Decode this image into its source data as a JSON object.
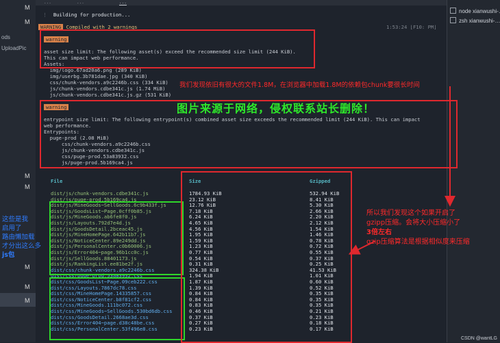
{
  "tabs": [
    "...",
    "...",
    "..."
  ],
  "sidebar": {
    "labels": [
      "ods",
      "UploadPic"
    ],
    "markers": [
      "M",
      "M",
      "M",
      "M",
      "M",
      "M",
      "M"
    ]
  },
  "right_panel": {
    "items": [
      "node  xianwushi-…",
      "zsh  xianwushi-…"
    ]
  },
  "terminal": {
    "building": "Building for production...",
    "compiled_badge": "WARNING",
    "compiled_text": " Compiled with 2 warnings",
    "time": "1:53:24 ⌊F10: PM⌋",
    "warn1_badge": "warning",
    "warn1_line1": "asset size limit: The following asset(s) exceed the recommended size limit (244 KiB).",
    "warn1_line2": "This can impact web performance.",
    "assets_header": "Assets:",
    "assets": [
      "  img/logo.67ad20a6.png (289 KiB)",
      "  img/userbg.3b781dae.jpg (340 KiB)",
      "  css/chunk-vendors.a9c2246b.css (334 KiB)",
      "  js/chunk-vendors.cdbe341c.js (1.74 MiB)",
      "  js/chunk-vendors.cdbe341c.js.gz (531 KiB)"
    ],
    "warn2_badge": "warning",
    "warn2_line1": "entrypoint size limit: The following entrypoint(s) combined asset size exceeds the recommended limit (244 KiB). This can impact",
    "warn2_line2": "web performance.",
    "entrypoints_header": "Entrypoints:",
    "entrypoints": [
      "  puge-prod (2.08 MiB)",
      "      css/chunk-vendors.a9c2246b.css",
      "      js/chunk-vendors.cdbe341c.js",
      "      css/puge-prod.53a83932.css",
      "      js/puge-prod.5b169ca4.js"
    ],
    "table": {
      "headers": {
        "file": "File",
        "size": "Size",
        "gzipped": "Gzipped"
      },
      "rows": [
        {
          "file": "dist/js/chunk-vendors.cdbe341c.js",
          "size": "1784.93 KiB",
          "gz": "532.94 KiB",
          "kind": "js"
        },
        {
          "file": "dist/js/puge-prod.5b169ca4.js",
          "size": "23.12 KiB",
          "gz": "8.41 KiB",
          "kind": "js"
        },
        {
          "file": "dist/js/MineGoods~SellGoods.6c9b433f.js",
          "size": "12.76 KiB",
          "gz": "5.30 KiB",
          "kind": "js"
        },
        {
          "file": "dist/js/GoodsList~Page.0cff0b85.js",
          "size": "7.18 KiB",
          "gz": "2.66 KiB",
          "kind": "js"
        },
        {
          "file": "dist/js/MineGoods.ab6fe8f0.js",
          "size": "6.24 KiB",
          "gz": "2.20 KiB",
          "kind": "js"
        },
        {
          "file": "dist/js/Layouts.792d7e4d.js",
          "size": "4.65 KiB",
          "gz": "2.12 KiB",
          "kind": "js"
        },
        {
          "file": "dist/js/GoodsDetail.2bceac45.js",
          "size": "4.56 KiB",
          "gz": "1.54 KiB",
          "kind": "js"
        },
        {
          "file": "dist/js/MineHomePage.642b11b7.js",
          "size": "1.95 KiB",
          "gz": "1.46 KiB",
          "kind": "js"
        },
        {
          "file": "dist/js/NoticeCenter.89e249dd.js",
          "size": "1.59 KiB",
          "gz": "0.78 KiB",
          "kind": "js"
        },
        {
          "file": "dist/js/PersonalCenter.c0b60006.js",
          "size": "1.23 KiB",
          "gz": "0.72 KiB",
          "kind": "js"
        },
        {
          "file": "dist/js/Error404~page.96b1cc0c.js",
          "size": "0.77 KiB",
          "gz": "0.55 KiB",
          "kind": "js"
        },
        {
          "file": "dist/js/SellGoods.88401173.js",
          "size": "0.54 KiB",
          "gz": "0.37 KiB",
          "kind": "js"
        },
        {
          "file": "dist/js/RankingList.ee81be2f.js",
          "size": "0.31 KiB",
          "gz": "0.25 KiB",
          "kind": "js"
        },
        {
          "file": "dist/css/chunk-vendors.a9c2246b.css",
          "size": "324.38 KiB",
          "gz": "41.53 KiB",
          "kind": "css"
        },
        {
          "file": "dist/css/puge-prod.53a83932.css",
          "size": "1.94 KiB",
          "gz": "1.01 KiB",
          "kind": "css"
        },
        {
          "file": "dist/css/GoodsList~Page.09ceb222.css",
          "size": "1.87 KiB",
          "gz": "0.60 KiB",
          "kind": "css"
        },
        {
          "file": "dist/css/Layouts.7867dc78.css",
          "size": "1.39 KiB",
          "gz": "0.52 KiB",
          "kind": "css"
        },
        {
          "file": "dist/css/MineHomePage.14335857.css",
          "size": "0.84 KiB",
          "gz": "0.35 KiB",
          "kind": "css"
        },
        {
          "file": "dist/css/NoticeCenter.b8f81cf2.css",
          "size": "0.84 KiB",
          "gz": "0.35 KiB",
          "kind": "css"
        },
        {
          "file": "dist/css/MineGoods.111bc072.css",
          "size": "0.83 KiB",
          "gz": "0.35 KiB",
          "kind": "css"
        },
        {
          "file": "dist/css/MineGoods~SellGoods.530bd6db.css",
          "size": "0.46 KiB",
          "gz": "0.21 KiB",
          "kind": "css"
        },
        {
          "file": "dist/css/GoodsDetail.2668ae3d.css",
          "size": "0.37 KiB",
          "gz": "0.23 KiB",
          "kind": "css"
        },
        {
          "file": "dist/css/Error404~page.d38c48be.css",
          "size": "0.27 KiB",
          "gz": "0.18 KiB",
          "kind": "css"
        },
        {
          "file": "dist/css/PersonalCenter.53f496e8.css",
          "size": "0.23 KiB",
          "gz": "0.17 KiB",
          "kind": "css"
        }
      ]
    }
  },
  "annotations": {
    "red_top": "我们发现依旧有很大的文件1.8M，在浏览器中加载1.8M的依赖包chunk要很长时间",
    "watermark": "图片来源于网络，侵权联系站长删除！",
    "blue_left": [
      "这些是我",
      "启用了",
      "路由懒加载",
      "才分出这么多",
      "js包"
    ],
    "right_lines": [
      "所以我们发现这个如果开启了",
      "gzipp压缩。会将大小压缩小了",
      "3倍左右",
      "gzip压缩算法是根据相似度来压缩"
    ]
  },
  "footer": "CSDN @wantLG",
  "colors": {
    "red": "#e0282e",
    "green": "#2fd62a",
    "blue": "#2f7cff",
    "badge": "#d9824a"
  }
}
